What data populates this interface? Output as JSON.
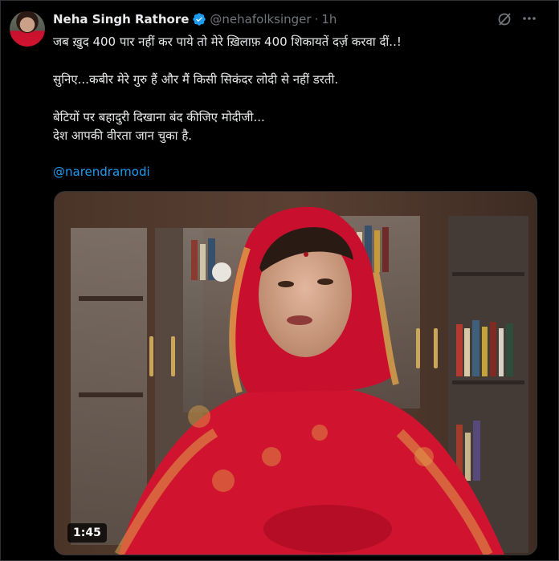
{
  "tweet": {
    "display_name": "Neha Singh Rathore",
    "handle": "@nehafolksinger",
    "separator": "·",
    "time": "1h",
    "lines": [
      "जब ख़ुद 400 पार नहीं कर पाये तो मेरे ख़िलाफ़ 400 शिकायतें दर्ज़ करवा दीं..!",
      "सुनिए...कबीर मेरे गुरु हैं और मैं किसी सिकंदर लोदी से नहीं डरती.",
      "बेटियों पर बहादुरी दिखाना बंद कीजिए मोदीजी...",
      "देश आपकी वीरता जान चुका है."
    ],
    "mention": "@narendramodi",
    "video_duration": "1:45"
  },
  "icons": {
    "verified": "verified-badge-icon",
    "grok": "grok-icon",
    "more": "more-options-icon"
  },
  "colors": {
    "background": "#000000",
    "text": "#e7e9ea",
    "muted": "#71767b",
    "link": "#1d9bf0",
    "verified": "#1d9bf0",
    "saree": "#d0142f"
  }
}
